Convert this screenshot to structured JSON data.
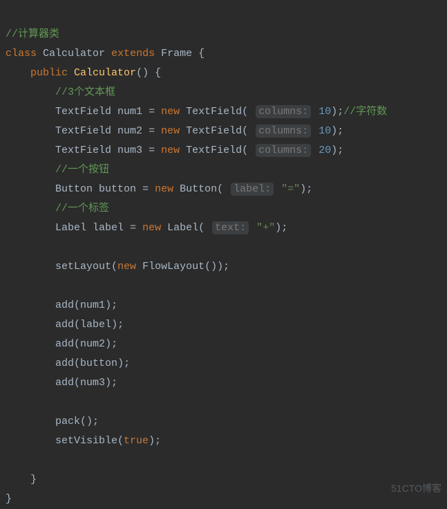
{
  "code": {
    "c_calc_class": "//计算器类",
    "kw_class": "class",
    "name_calc": "Calculator",
    "kw_extends": "extends",
    "name_frame": "Frame",
    "brace_open": " {",
    "kw_public": "public",
    "ctor_name": "Calculator",
    "ctor_sig": "() {",
    "c_3textbox": "//3个文本框",
    "tf_type": "TextField",
    "num1": "num1",
    "num2": "num2",
    "num3": "num3",
    "eq": " = ",
    "kw_new": "new",
    "hint_columns": "columns:",
    "v10": "10",
    "v20": "20",
    "semiparen": ");",
    "c_chars": "//字符数",
    "c_btn": "//一个按钮",
    "btn_type": "Button",
    "btn_var": "button",
    "hint_label": "label:",
    "str_eq": "\"=\"",
    "c_label": "//一个标签",
    "lbl_type": "Label",
    "lbl_var": "label",
    "hint_text": "text:",
    "str_plus": "\"+\"",
    "setLayout": "setLayout",
    "flow": "FlowLayout",
    "empty_call": "());",
    "add": "add",
    "pack": "pack",
    "setVisible": "setVisible",
    "true": "true",
    "semi": ";",
    "close_brace": "}",
    "parenL": "(",
    "parenR": ")"
  },
  "watermark": "51CTO博客"
}
